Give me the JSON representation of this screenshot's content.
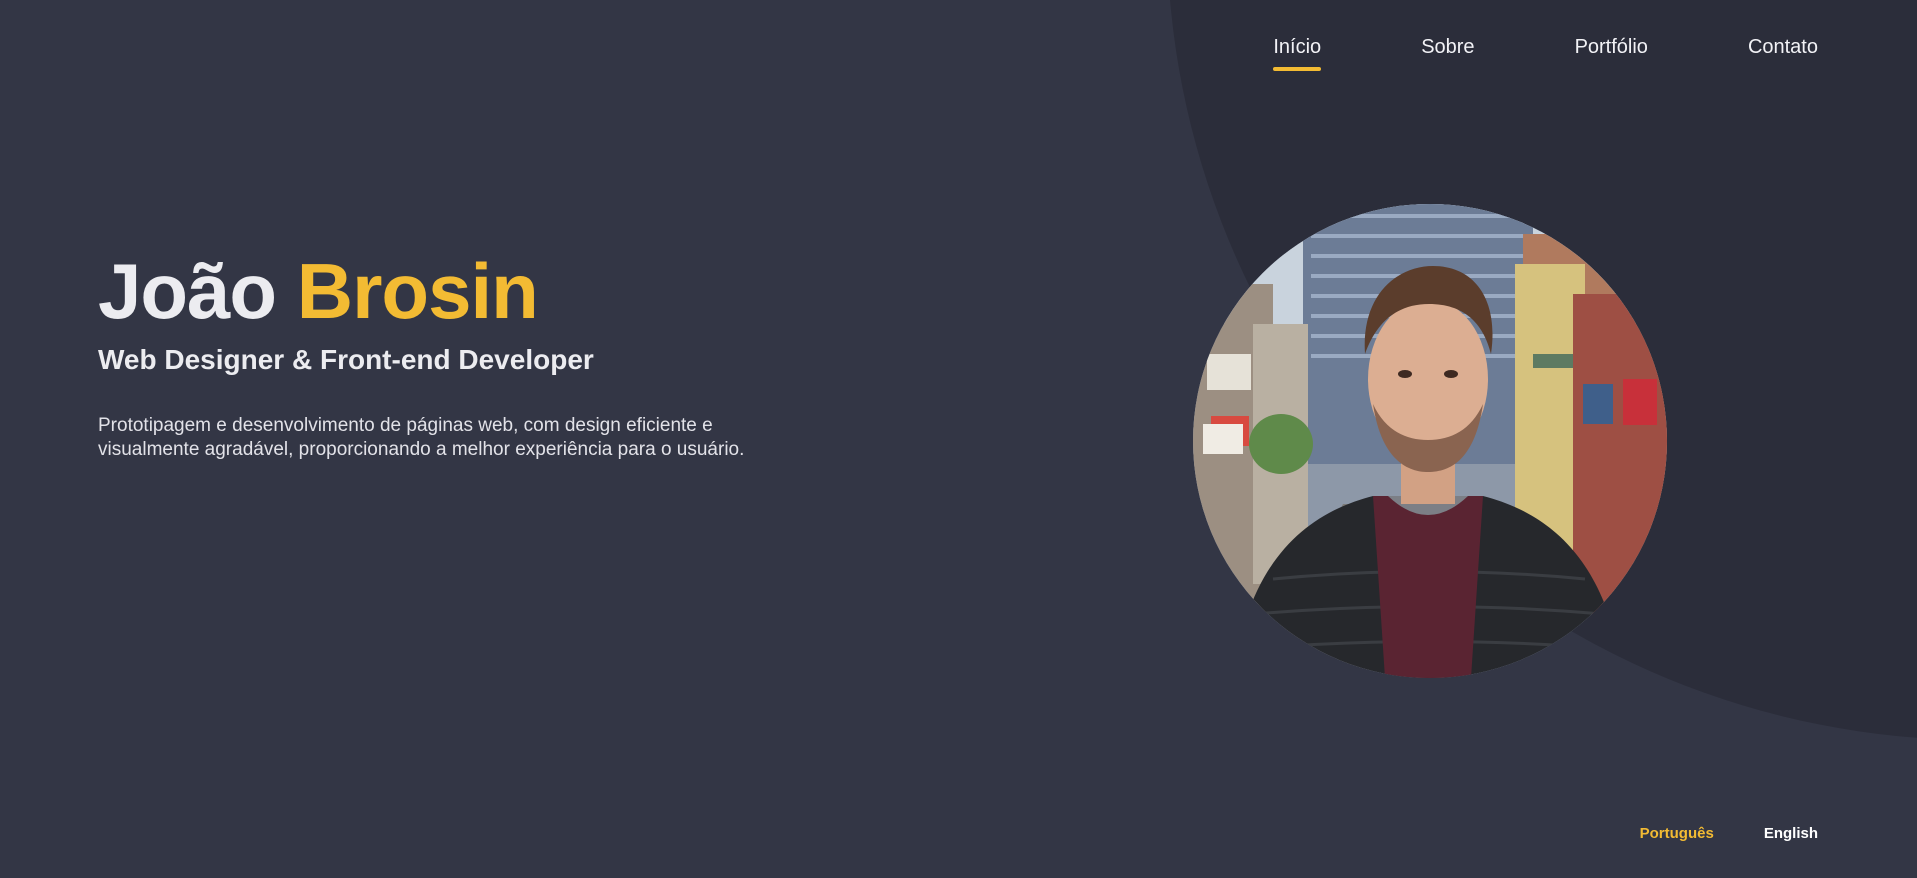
{
  "nav": {
    "items": [
      {
        "label": "Início",
        "active": true
      },
      {
        "label": "Sobre",
        "active": false
      },
      {
        "label": "Portfólio",
        "active": false
      },
      {
        "label": "Contato",
        "active": false
      }
    ]
  },
  "hero": {
    "first_name": "João",
    "last_name": "Brosin",
    "role": "Web Designer & Front-end Developer",
    "description": "Prototipagem e desenvolvimento de páginas web, com design eficiente e visualmente agradável, proporcionando a melhor experiência para o usuário."
  },
  "portrait": {
    "icon": "profile-photo"
  },
  "language": {
    "options": [
      {
        "label": "Português",
        "active": true
      },
      {
        "label": "English",
        "active": false
      }
    ]
  },
  "colors": {
    "background": "#333645",
    "background_shape": "#2b2d3a",
    "accent": "#f3bb33",
    "text": "#ececf0"
  }
}
